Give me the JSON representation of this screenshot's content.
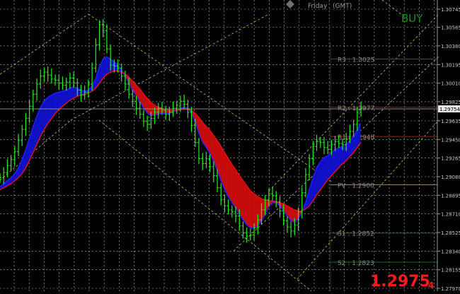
{
  "header": {
    "day_label": "Friday",
    "tz_label": "(GMT)"
  },
  "signal": {
    "text": "BUY",
    "color": "#1e8a1e"
  },
  "price_display": {
    "main": "1.2975",
    "sub": "4",
    "color": "#ff1a1a"
  },
  "current_price": {
    "label": "1.29754",
    "value": 1.29754
  },
  "levels": [
    {
      "name": "R3",
      "label": "R3 : 1.3025",
      "value": 1.3025,
      "color": "#b01818"
    },
    {
      "name": "R2",
      "label": "R2 : 1.2977",
      "value": 1.2977,
      "color": "#b01818"
    },
    {
      "name": "R1",
      "label": "R1 : 1.2948",
      "value": 1.2948,
      "color": "#b01818"
    },
    {
      "name": "PV",
      "label": "PV : 1.2900",
      "value": 1.29,
      "color": "#e07800"
    },
    {
      "name": "S1",
      "label": "S1 : 1.2852",
      "value": 1.2852,
      "color": "#1a6a1a"
    },
    {
      "name": "S2",
      "label": "S2 : 1.2823",
      "value": 1.2823,
      "color": "#1a6a1a"
    }
  ],
  "chart_data": {
    "type": "line",
    "y_axis_ticks": [
      "1.30745",
      "1.30565",
      "1.30380",
      "1.30195",
      "1.30010",
      "1.29825",
      "1.29635",
      "1.29450",
      "1.29265",
      "1.29080",
      "1.28895",
      "1.28710",
      "1.28525",
      "1.28340",
      "1.28155",
      "1.27970"
    ],
    "ylim": [
      1.2797,
      1.30745
    ],
    "grid": true,
    "price_series_color": "#22ee22",
    "band_colors": {
      "bull_fill": "#1010c8",
      "bear_fill": "#c80c0c"
    },
    "price": [
      1.2907,
      1.2912,
      1.2919,
      1.2925,
      1.2933,
      1.2944,
      1.2955,
      1.2966,
      1.2978,
      1.299,
      1.3,
      1.3008,
      1.3012,
      1.3009,
      1.3005,
      1.3004,
      1.3001,
      1.2999,
      1.3002,
      1.3006,
      1.3001,
      1.2994,
      1.2989,
      1.2992,
      1.3,
      1.3016,
      1.3039,
      1.3059,
      1.3053,
      1.3035,
      1.3019,
      1.3018,
      1.3016,
      1.3008,
      1.3,
      1.299,
      1.2983,
      1.2976,
      1.297,
      1.2963,
      1.296,
      1.2966,
      1.2972,
      1.2976,
      1.2974,
      1.297,
      1.2972,
      1.2976,
      1.2979,
      1.2983,
      1.298,
      1.2972,
      1.2959,
      1.2942,
      1.2926,
      1.2921,
      1.2926,
      1.2918,
      1.2909,
      1.2897,
      1.2885,
      1.2879,
      1.2875,
      1.2873,
      1.2869,
      1.2859,
      1.2852,
      1.2849,
      1.285,
      1.2857,
      1.2865,
      1.2875,
      1.2885,
      1.2891,
      1.2889,
      1.2883,
      1.2874,
      1.2864,
      1.2858,
      1.2854,
      1.286,
      1.2873,
      1.2892,
      1.291,
      1.2926,
      1.2938,
      1.2943,
      1.2942,
      1.2937,
      1.2935,
      1.294,
      1.2943,
      1.2941,
      1.294,
      1.2946,
      1.2953,
      1.296,
      1.2972,
      1.2976
    ],
    "ma_fast": [
      1.2898,
      1.2901,
      1.2904,
      1.2907,
      1.2911,
      1.2917,
      1.2925,
      1.2935,
      1.2946,
      1.2958,
      1.2968,
      1.2977,
      1.2983,
      1.2987,
      1.2989,
      1.2991,
      1.2992,
      1.2993,
      1.2994,
      1.2996,
      1.2997,
      1.2996,
      1.2994,
      1.2993,
      1.2994,
      1.2998,
      1.3006,
      1.3017,
      1.3025,
      1.3027,
      1.3025,
      1.3022,
      1.3019,
      1.3014,
      1.3008,
      1.3001,
      1.2994,
      1.2988,
      1.2982,
      1.2976,
      1.2971,
      1.2969,
      1.2969,
      1.297,
      1.2971,
      1.2971,
      1.2971,
      1.2972,
      1.2974,
      1.2976,
      1.2977,
      1.2976,
      1.2971,
      1.2962,
      1.2951,
      1.2942,
      1.2937,
      1.2931,
      1.2923,
      1.2914,
      1.2904,
      1.2895,
      1.2888,
      1.2882,
      1.2877,
      1.2871,
      1.2865,
      1.286,
      1.2857,
      1.2857,
      1.2859,
      1.2864,
      1.2871,
      1.2878,
      1.2882,
      1.2882,
      1.2879,
      1.2874,
      1.2869,
      1.2864,
      1.2863,
      1.2866,
      1.2873,
      1.2883,
      1.2895,
      1.2907,
      1.2917,
      1.2923,
      1.2927,
      1.2929,
      1.2932,
      1.2935,
      1.2937,
      1.2938,
      1.294,
      1.2944,
      1.2948,
      1.2955,
      1.2961
    ],
    "ma_slow": [
      1.2895,
      1.2897,
      1.2899,
      1.2901,
      1.2904,
      1.2907,
      1.2911,
      1.2917,
      1.2924,
      1.2932,
      1.294,
      1.2948,
      1.2955,
      1.2961,
      1.2966,
      1.2971,
      1.2975,
      1.2978,
      1.2981,
      1.2984,
      1.2986,
      1.2988,
      1.2989,
      1.299,
      1.2991,
      1.2993,
      1.2996,
      1.3001,
      1.3006,
      1.301,
      1.3012,
      1.3013,
      1.3013,
      1.3012,
      1.301,
      1.3007,
      1.3003,
      1.2999,
      1.2995,
      1.299,
      1.2986,
      1.2982,
      1.2979,
      1.2977,
      1.2976,
      1.2975,
      1.2974,
      1.2974,
      1.2974,
      1.2975,
      1.2975,
      1.2975,
      1.2974,
      1.2971,
      1.2967,
      1.2962,
      1.2958,
      1.2954,
      1.2949,
      1.2944,
      1.2938,
      1.2932,
      1.2926,
      1.292,
      1.2915,
      1.2909,
      1.2904,
      1.2899,
      1.2894,
      1.2891,
      1.2888,
      1.2886,
      1.2885,
      1.2884,
      1.2884,
      1.2883,
      1.2882,
      1.2881,
      1.2879,
      1.2877,
      1.2875,
      1.2874,
      1.2874,
      1.2876,
      1.2879,
      1.2884,
      1.289,
      1.2895,
      1.29,
      1.2905,
      1.2909,
      1.2913,
      1.2917,
      1.2921,
      1.2924,
      1.2928,
      1.2932,
      1.2937,
      1.2942
    ]
  }
}
